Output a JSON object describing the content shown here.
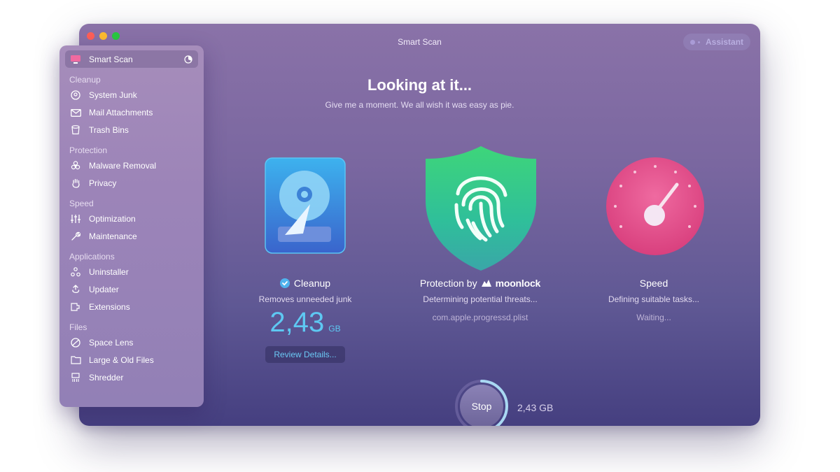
{
  "window": {
    "title": "Smart Scan",
    "assistant_label": "Assistant"
  },
  "main": {
    "heading": "Looking at it...",
    "subheading": "Give me a moment. We all wish it was easy as pie."
  },
  "cleanup": {
    "title": "Cleanup",
    "description": "Removes unneeded junk",
    "size_value": "2,43",
    "size_unit": "GB",
    "review_label": "Review Details..."
  },
  "protection": {
    "title_prefix": "Protection by",
    "brand": "moonlock",
    "description": "Determining potential threats...",
    "current_file": "com.apple.progressd.plist"
  },
  "speed": {
    "title": "Speed",
    "description": "Defining suitable tasks...",
    "status": "Waiting..."
  },
  "scan_control": {
    "stop_label": "Stop",
    "scanned_size": "2,43 GB",
    "progress_fraction": 0.42
  },
  "sidebar": {
    "active_item": "Smart Scan",
    "sections": {
      "cleanup": "Cleanup",
      "protection": "Protection",
      "speed": "Speed",
      "applications": "Applications",
      "files": "Files"
    },
    "items": {
      "smart_scan": "Smart Scan",
      "system_junk": "System Junk",
      "mail_attachments": "Mail Attachments",
      "trash_bins": "Trash Bins",
      "malware_removal": "Malware Removal",
      "privacy": "Privacy",
      "optimization": "Optimization",
      "maintenance": "Maintenance",
      "uninstaller": "Uninstaller",
      "updater": "Updater",
      "extensions": "Extensions",
      "space_lens": "Space Lens",
      "large_old_files": "Large & Old Files",
      "shredder": "Shredder"
    }
  },
  "colors": {
    "accent_blue": "#5ec8f2",
    "shield_green": "#3fcf92",
    "speed_pink": "#e8558f",
    "check_blue": "#4fb3ee"
  }
}
